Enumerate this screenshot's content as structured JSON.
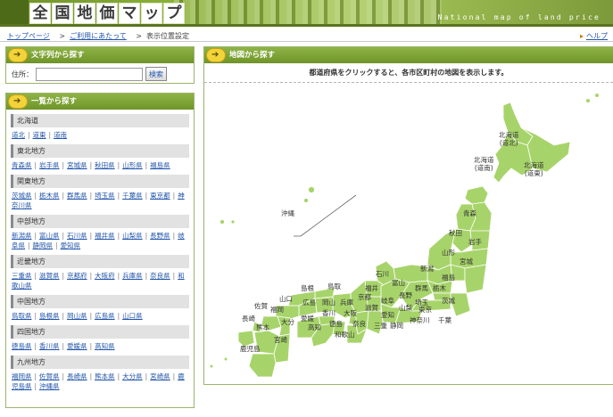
{
  "header": {
    "title_chars": [
      "全",
      "国",
      "地",
      "価",
      "マ",
      "ッ",
      "プ"
    ],
    "subtitle": "National map of land price"
  },
  "breadcrumb": {
    "top": "トップページ",
    "usage": "ご利用にあたって",
    "current": "表示位置設定"
  },
  "help_link": "ヘルプ",
  "search_panel": {
    "title": "文字列から探す",
    "label": "住所：",
    "input_value": "",
    "button": "検索"
  },
  "list_panel": {
    "title": "一覧から探す",
    "regions": [
      {
        "name": "北海道",
        "prefs": [
          "道北",
          "道東",
          "道南"
        ]
      },
      {
        "name": "東北地方",
        "prefs": [
          "青森県",
          "岩手県",
          "宮城県",
          "秋田県",
          "山形県",
          "福島県"
        ]
      },
      {
        "name": "関東地方",
        "prefs": [
          "茨城県",
          "栃木県",
          "群馬県",
          "埼玉県",
          "千葉県",
          "東京都",
          "神奈川県"
        ]
      },
      {
        "name": "中部地方",
        "prefs": [
          "新潟県",
          "富山県",
          "石川県",
          "福井県",
          "山梨県",
          "長野県",
          "岐阜県",
          "静岡県",
          "愛知県"
        ]
      },
      {
        "name": "近畿地方",
        "prefs": [
          "三重県",
          "滋賀県",
          "京都府",
          "大阪府",
          "兵庫県",
          "奈良県",
          "和歌山県"
        ]
      },
      {
        "name": "中国地方",
        "prefs": [
          "鳥取県",
          "島根県",
          "岡山県",
          "広島県",
          "山口県"
        ]
      },
      {
        "name": "四国地方",
        "prefs": [
          "徳島県",
          "香川県",
          "愛媛県",
          "高知県"
        ]
      },
      {
        "name": "九州地方",
        "prefs": [
          "福岡県",
          "佐賀県",
          "長崎県",
          "熊本県",
          "大分県",
          "宮崎県",
          "鹿児島県",
          "沖縄県"
        ]
      }
    ]
  },
  "map_panel": {
    "title": "地図から探す",
    "message": "都道府県をクリックすると、各市区町村の地図を表示します。",
    "labels": {
      "hokkaido_north": "北海道\n(道北)",
      "hokkaido_south": "北海道\n(道南)",
      "hokkaido_east": "北海道\n(道東)",
      "okinawa": "沖縄",
      "aomori": "青森",
      "akita": "秋田",
      "iwate": "岩手",
      "yamagata": "山形",
      "miyagi": "宮城",
      "niigata": "新潟",
      "fukushima": "福島",
      "ishikawa": "石川",
      "toyama": "富山",
      "gunma": "群馬",
      "tochigi": "栃木",
      "ibaraki": "茨城",
      "shimane": "島根",
      "tottori": "鳥取",
      "fukui": "福井",
      "yamaguchi": "山口",
      "hiroshima": "広島",
      "okayama": "岡山",
      "hyogo": "兵庫",
      "kyoto": "京都",
      "gifu": "岐阜",
      "nagano": "長野",
      "saitama": "埼玉",
      "saga": "佐賀",
      "fukuoka": "福岡",
      "kagawa": "香川",
      "osaka": "大阪",
      "shiga": "滋賀",
      "yamanashi": "山梨",
      "tokyo": "東京",
      "nagasaki": "長崎",
      "oita": "大分",
      "ehime": "愛媛",
      "aichi": "愛知",
      "kanagawa": "神奈川",
      "chiba": "千葉",
      "kumamoto": "熊本",
      "kochi": "高知",
      "tokushima": "徳島",
      "nara": "奈良",
      "mie": "三重",
      "shizuoka": "静岡",
      "miyazaki": "宮崎",
      "wakayama": "和歌山",
      "kagoshima": "鹿児島"
    }
  },
  "colors": {
    "header_green": "#8db23b",
    "map_green": "#a7d46a",
    "link_blue": "#2255aa"
  }
}
